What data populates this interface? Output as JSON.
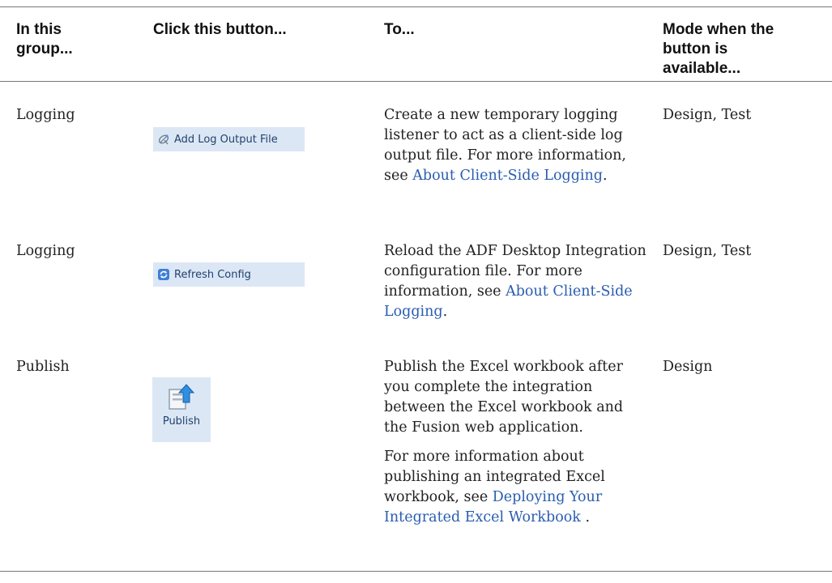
{
  "table": {
    "headers": {
      "group": [
        "In this",
        "group..."
      ],
      "button": "Click this button...",
      "to": "To...",
      "mode": [
        "Mode when the",
        "button is",
        "available..."
      ]
    },
    "rows": [
      {
        "group": "Logging",
        "button_label": "Add Log Output File",
        "button_icon": "satellite-dish-icon",
        "to_text": "Create a new temporary logging listener to act as a client-side log output file. For more information, see ",
        "to_link": "About Client-Side Logging",
        "to_after": ".",
        "mode": "Design, Test"
      },
      {
        "group": "Logging",
        "button_label": "Refresh Config",
        "button_icon": "refresh-icon",
        "to_text": "Reload the ADF Desktop Integration configuration file. For more information, see ",
        "to_link": "About Client-Side Logging",
        "to_after": ".",
        "mode": "Design, Test"
      },
      {
        "group": "Publish",
        "button_label": "Publish",
        "button_icon": "publish-icon",
        "to_text": "Publish the Excel workbook after you complete the integration between the Excel workbook and the Fusion web application.",
        "to_para2_text": "For more information about publishing an integrated Excel workbook, see ",
        "to_para2_link": "Deploying Your Integrated Excel Workbook",
        "to_para2_after": " .",
        "mode": "Design"
      }
    ]
  }
}
